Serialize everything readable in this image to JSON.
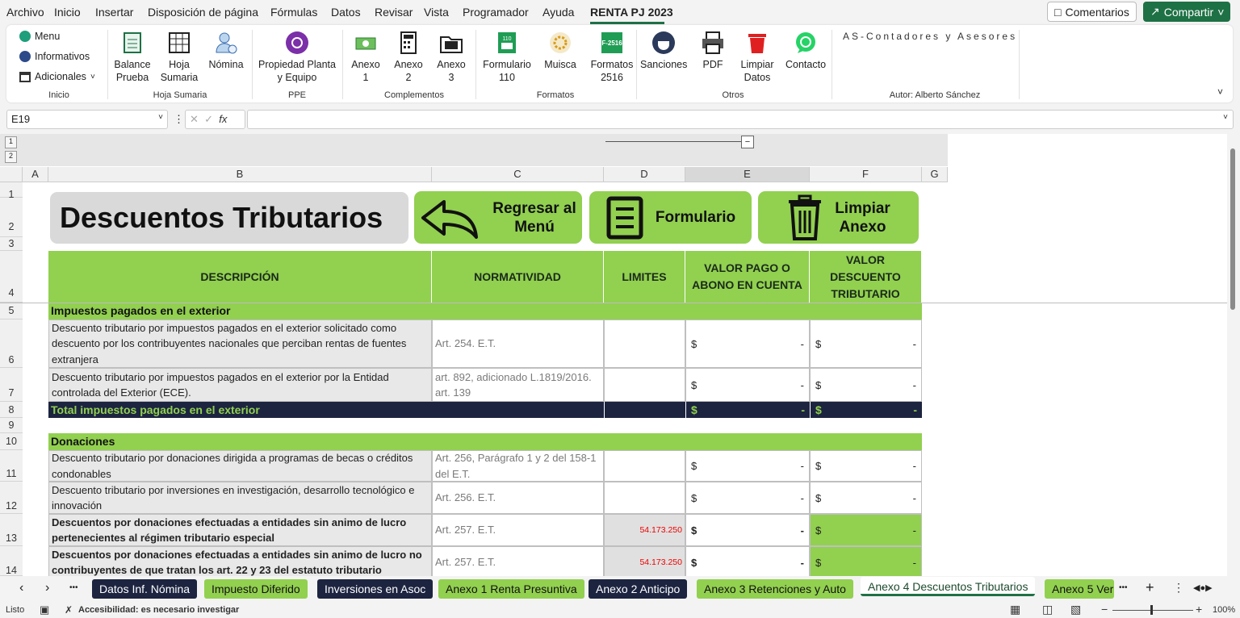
{
  "menu": [
    "Archivo",
    "Inicio",
    "Insertar",
    "Disposición de página",
    "Fórmulas",
    "Datos",
    "Revisar",
    "Vista",
    "Programador",
    "Ayuda",
    "RENTA PJ 2023"
  ],
  "top_buttons": {
    "comments": "Comentarios",
    "share": "Compartir"
  },
  "ribbon": {
    "inicio_items": [
      "Menu",
      "Informativos",
      "Adicionales"
    ],
    "buttons": {
      "balance": "Balance\nPrueba",
      "hoja": "Hoja\nSumaria",
      "nomina": "Nómina",
      "propiedad": "Propiedad Planta\ny Equipo",
      "anexo1": "Anexo\n1",
      "anexo2": "Anexo\n2",
      "anexo3": "Anexo\n3",
      "formulario110": "Formulario\n110",
      "muisca": "Muisca",
      "formatos2516": "Formatos\n2516",
      "sanciones": "Sanciones",
      "pdf": "PDF",
      "limpiar": "Limpiar\nDatos",
      "contacto": "Contacto"
    },
    "groups": {
      "inicio": "Inicio",
      "hoja_sumaria": "Hoja Sumaria",
      "ppe": "PPE",
      "complementos": "Complementos",
      "formatos": "Formatos",
      "otros": "Otros"
    },
    "brand": "AS-Contadores y Asesores",
    "author": "Autor: Alberto Sánchez",
    "icon_labels": {
      "f110": "110",
      "f2516": "F-2516"
    }
  },
  "formula_bar": {
    "name_box": "E19",
    "fx": "fx",
    "value": ""
  },
  "columns": [
    "A",
    "B",
    "C",
    "D",
    "E",
    "F",
    "G"
  ],
  "rows": [
    "1",
    "2",
    "3",
    "4",
    "5",
    "6",
    "7",
    "8",
    "9",
    "10",
    "11",
    "12",
    "13",
    "14"
  ],
  "outline_levels": [
    "1",
    "2"
  ],
  "sheet": {
    "title": "Descuentos Tributarios",
    "btn_regresar": "Regresar al\nMenú",
    "btn_formulario": "Formulario",
    "btn_limpiar": "Limpiar\nAnexo",
    "headers": [
      "DESCRIPCIÓN",
      "NORMATIVIDAD",
      "LIMITES",
      "VALOR PAGO O\nABONO EN CUENTA",
      "VALOR\nDESCUENTO\nTRIBUTARIO"
    ],
    "sec1": "Impuestos pagados en el exterior",
    "r6_desc": "Descuento tributario por impuestos pagados  en el exterior solicitado como descuento por los contribuyentes nacionales que perciban rentas de fuentes extranjera",
    "r6_norm": "Art. 254. E.T.",
    "r7_desc": "Descuento tributario por impuestos pagados  en el exterior por la Entidad controlada del Exterior (ECE).",
    "r7_norm": "art. 892, adicionado L.1819/2016. art. 139",
    "total1": "Total impuestos pagados en el exterior",
    "sec2": "Donaciones",
    "r11_desc": "Descuento tributario por donaciones dirigida a programas de becas o créditos condonables",
    "r11_norm": "Art. 256, Parágrafo 1 y 2 del 158-1 del E.T.",
    "r12_desc": "Descuento tributario por inversiones en investigación, desarrollo tecnológico e innovación",
    "r12_norm": "Art. 256. E.T.",
    "r13_desc": "Descuentos  por donaciones efectuadas a entidades sin animo de lucro pertenecientes al régimen tributario especial",
    "r13_norm": "Art. 257. E.T.",
    "r13_lim": "54.173.250",
    "r14_desc": "Descuentos por donaciones efectuadas a entidades sin animo de lucro no contribuyentes de que tratan los art. 22 y 23 del estatuto tributario",
    "r14_norm": "Art. 257. E.T.",
    "r14_lim": "54.173.250",
    "cur": "$",
    "dash": "-"
  },
  "tabs": [
    "Datos Inf. Nómina",
    "Impuesto Diferido",
    "Inversiones en Asoc",
    "Anexo 1 Renta Presuntiva",
    "Anexo 2 Anticipo",
    "Anexo 3 Retenciones y Auto",
    "Anexo 4 Descuentos Tributarios",
    "Anexo 5 Ver"
  ],
  "tab_nav": {
    "prev": "‹",
    "next": "›",
    "more": "•••",
    "add": "+",
    "menu": "⋮"
  },
  "status": {
    "ready": "Listo",
    "accessibility": "Accesibilidad: es necesario investigar",
    "zoom": "100%",
    "minus": "−",
    "plus": "+"
  },
  "colors": {
    "green": "#92d050",
    "navy": "#1c2440",
    "excel_green": "#1e7145",
    "red_limit": "#e00000"
  }
}
